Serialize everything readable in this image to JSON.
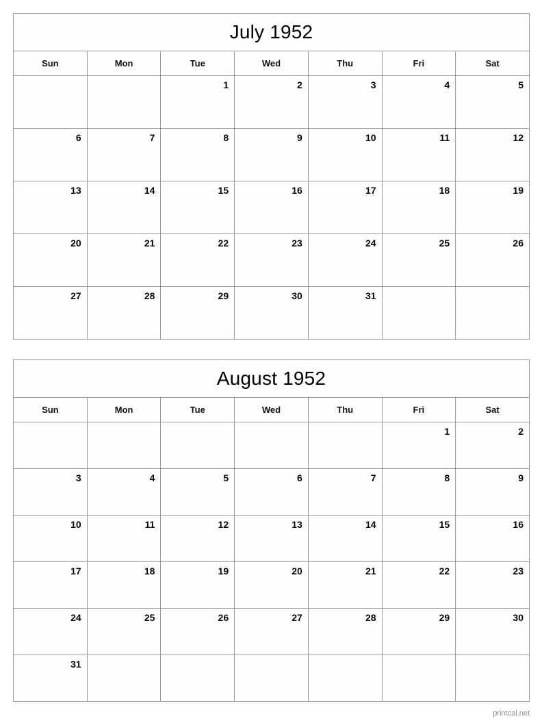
{
  "document": {
    "kind": "printable-two-month-calendar",
    "year": "1952"
  },
  "footer": {
    "source_label": "printcal.net"
  },
  "weekdays": [
    {
      "short": "Sun"
    },
    {
      "short": "Mon"
    },
    {
      "short": "Tue"
    },
    {
      "short": "Wed"
    },
    {
      "short": "Thu"
    },
    {
      "short": "Fri"
    },
    {
      "short": "Sat"
    }
  ],
  "months": [
    {
      "title": "July 1952",
      "name": "July",
      "year": "1952",
      "first_weekday": "Tue",
      "days_in_month": 31,
      "weeks": [
        [
          "",
          "",
          "1",
          "2",
          "3",
          "4",
          "5"
        ],
        [
          "6",
          "7",
          "8",
          "9",
          "10",
          "11",
          "12"
        ],
        [
          "13",
          "14",
          "15",
          "16",
          "17",
          "18",
          "19"
        ],
        [
          "20",
          "21",
          "22",
          "23",
          "24",
          "25",
          "26"
        ],
        [
          "27",
          "28",
          "29",
          "30",
          "31",
          "",
          ""
        ]
      ]
    },
    {
      "title": "August 1952",
      "name": "August",
      "year": "1952",
      "first_weekday": "Fri",
      "days_in_month": 31,
      "weeks": [
        [
          "",
          "",
          "",
          "",
          "",
          "1",
          "2"
        ],
        [
          "3",
          "4",
          "5",
          "6",
          "7",
          "8",
          "9"
        ],
        [
          "10",
          "11",
          "12",
          "13",
          "14",
          "15",
          "16"
        ],
        [
          "17",
          "18",
          "19",
          "20",
          "21",
          "22",
          "23"
        ],
        [
          "24",
          "25",
          "26",
          "27",
          "28",
          "29",
          "30"
        ],
        [
          "31",
          "",
          "",
          "",
          "",
          "",
          ""
        ]
      ]
    }
  ]
}
